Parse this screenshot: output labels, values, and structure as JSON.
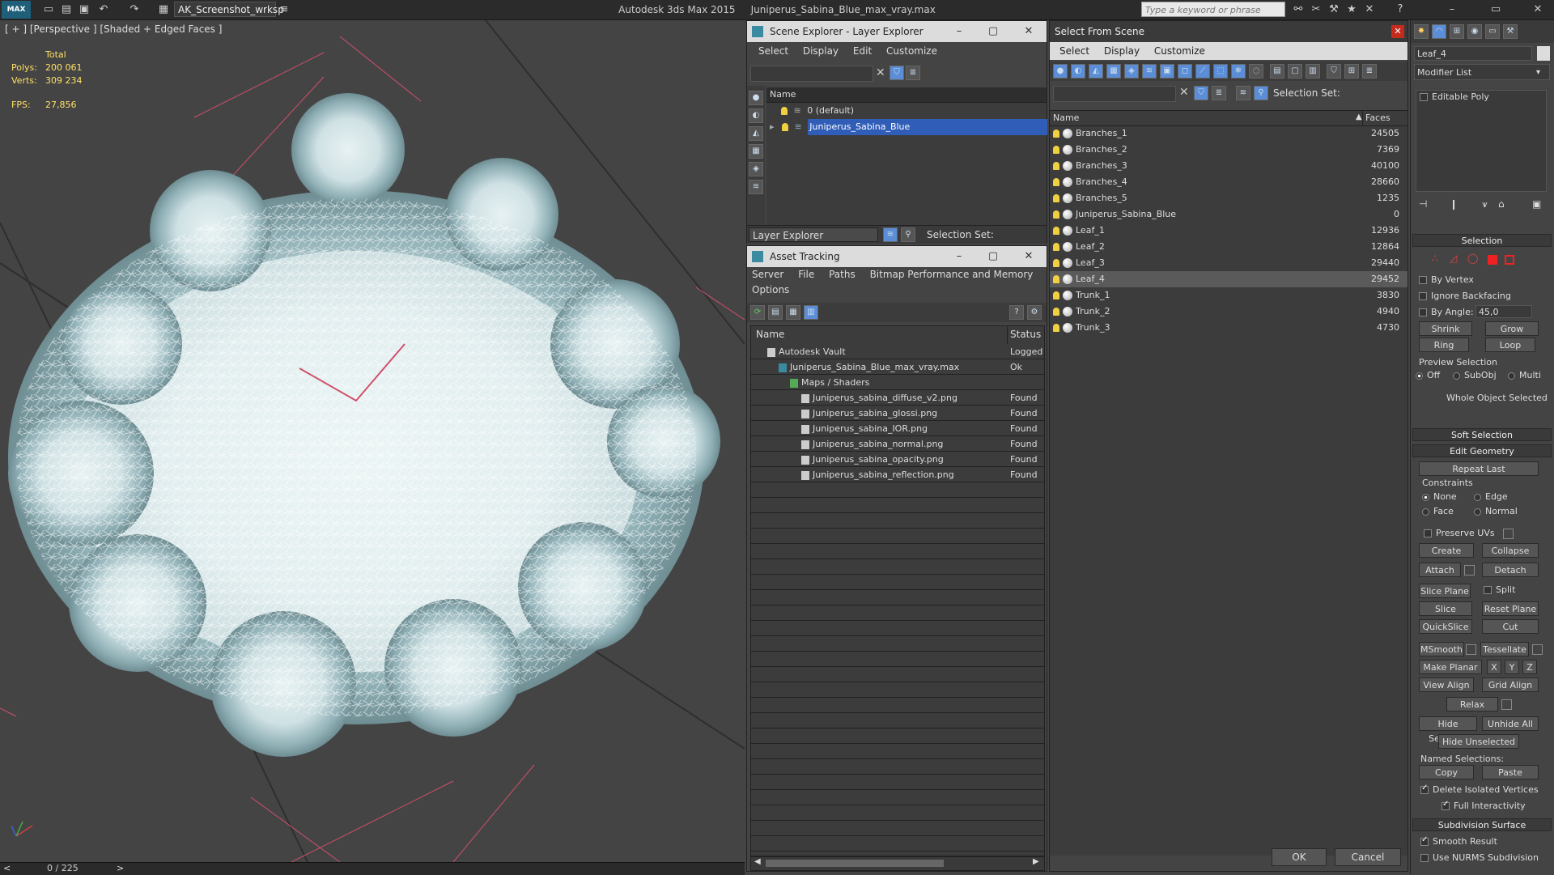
{
  "window": {
    "logo": "MAX",
    "workspace": "AK_Screenshot_wrksp",
    "app_name": "Autodesk 3ds Max  2015",
    "file_name": "Juniperus_Sabina_Blue_max_vray.max",
    "search_placeholder": "Type a keyword or phrase"
  },
  "viewport": {
    "label": "[ + ] [Perspective ] [Shaded + Edged Faces ]",
    "stats_header": "Total",
    "polys_label": "Polys:",
    "polys_value": "200 061",
    "verts_label": "Verts:",
    "verts_value": "309 234",
    "fps_label": "FPS:",
    "fps_value": "27,856",
    "timeline": "0 / 225"
  },
  "layer_explorer": {
    "title": "Scene Explorer - Layer Explorer",
    "menu": [
      "Select",
      "Display",
      "Edit",
      "Customize"
    ],
    "column": "Name",
    "layers": [
      "0 (default)",
      "Juniperus_Sabina_Blue"
    ],
    "footer_label": "Layer Explorer",
    "selection_set": "Selection Set:"
  },
  "asset_tracking": {
    "title": "Asset Tracking",
    "menu": [
      "Server",
      "File",
      "Paths",
      "Bitmap Performance and Memory"
    ],
    "menu2": "Options",
    "col_name": "Name",
    "col_status": "Status",
    "rows": [
      {
        "name": "Autodesk Vault",
        "status": "Logged",
        "indent": 0
      },
      {
        "name": "Juniperus_Sabina_Blue_max_vray.max",
        "status": "Ok",
        "indent": 1
      },
      {
        "name": "Maps / Shaders",
        "status": "",
        "indent": 2
      },
      {
        "name": "Juniperus_sabina_diffuse_v2.png",
        "status": "Found",
        "indent": 3
      },
      {
        "name": "Juniperus_sabina_glossi.png",
        "status": "Found",
        "indent": 3
      },
      {
        "name": "Juniperus_sabina_IOR.png",
        "status": "Found",
        "indent": 3
      },
      {
        "name": "Juniperus_sabina_normal.png",
        "status": "Found",
        "indent": 3
      },
      {
        "name": "Juniperus_sabina_opacity.png",
        "status": "Found",
        "indent": 3
      },
      {
        "name": "Juniperus_sabina_reflection.png",
        "status": "Found",
        "indent": 3
      }
    ]
  },
  "select_from_scene": {
    "title": "Select From Scene",
    "menu": [
      "Select",
      "Display",
      "Customize"
    ],
    "selection_set": "Selection Set:",
    "col_name": "Name",
    "col_faces": "Faces",
    "rows": [
      {
        "name": "Branches_1",
        "faces": "24505"
      },
      {
        "name": "Branches_2",
        "faces": "7369"
      },
      {
        "name": "Branches_3",
        "faces": "40100"
      },
      {
        "name": "Branches_4",
        "faces": "28660"
      },
      {
        "name": "Branches_5",
        "faces": "1235"
      },
      {
        "name": "Juniperus_Sabina_Blue",
        "faces": "0"
      },
      {
        "name": "Leaf_1",
        "faces": "12936"
      },
      {
        "name": "Leaf_2",
        "faces": "12864"
      },
      {
        "name": "Leaf_3",
        "faces": "29440"
      },
      {
        "name": "Leaf_4",
        "faces": "29452"
      },
      {
        "name": "Trunk_1",
        "faces": "3830"
      },
      {
        "name": "Trunk_2",
        "faces": "4940"
      },
      {
        "name": "Trunk_3",
        "faces": "4730"
      }
    ],
    "selected_index": 9,
    "ok": "OK",
    "cancel": "Cancel"
  },
  "command_panel": {
    "object_name": "Leaf_4",
    "modifier_list": "Modifier List",
    "stack_item": "Editable Poly",
    "selection": {
      "title": "Selection",
      "by_vertex": "By Vertex",
      "ignore_backfacing": "Ignore Backfacing",
      "by_angle": "By Angle:",
      "angle_value": "45,0",
      "shrink": "Shrink",
      "grow": "Grow",
      "ring": "Ring",
      "loop": "Loop",
      "preview_selection": "Preview Selection",
      "off": "Off",
      "subobj": "SubObj",
      "multi": "Multi",
      "whole_object": "Whole Object Selected"
    },
    "soft_selection": "Soft Selection",
    "edit_geometry": {
      "title": "Edit Geometry",
      "repeat_last": "Repeat Last",
      "constraints": "Constraints",
      "none": "None",
      "edge": "Edge",
      "face": "Face",
      "normal": "Normal",
      "preserve_uvs": "Preserve UVs",
      "create": "Create",
      "collapse": "Collapse",
      "attach": "Attach",
      "detach": "Detach",
      "slice_plane": "Slice Plane",
      "split": "Split",
      "slice": "Slice",
      "reset_plane": "Reset Plane",
      "quickslice": "QuickSlice",
      "cut": "Cut",
      "msmooth": "MSmooth",
      "tessellate": "Tessellate",
      "make_planar": "Make Planar",
      "x": "X",
      "y": "Y",
      "z": "Z",
      "view_align": "View Align",
      "grid_align": "Grid Align",
      "relax": "Relax",
      "hide_selected": "Hide Selected",
      "unhide_all": "Unhide All",
      "hide_unselected": "Hide Unselected",
      "named_selections": "Named Selections:",
      "copy": "Copy",
      "paste": "Paste",
      "delete_isolated": "Delete Isolated Vertices",
      "full_interactivity": "Full Interactivity"
    },
    "subdivision": {
      "title": "Subdivision Surface",
      "smooth_result": "Smooth Result",
      "use_nurms": "Use NURMS Subdivision"
    }
  },
  "colors": {
    "selection_blue": "#2f5db8",
    "stats_yellow": "#ffe066",
    "foliage": "#8fb8c0"
  }
}
